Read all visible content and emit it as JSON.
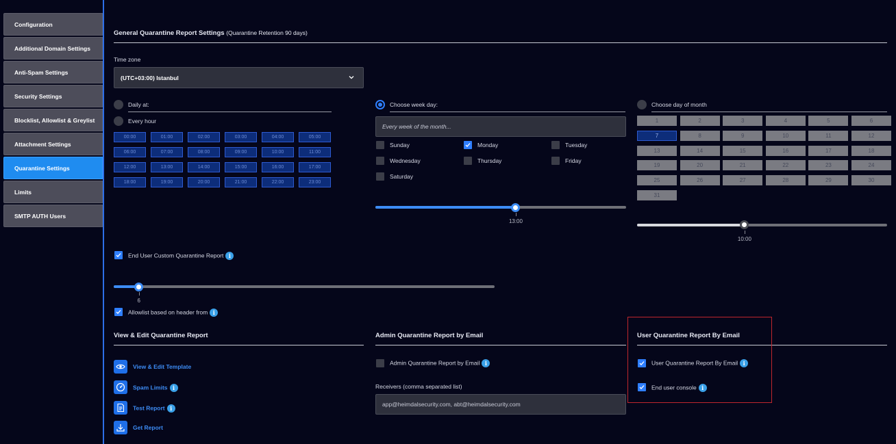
{
  "sidebar": {
    "items": [
      {
        "label": "Configuration",
        "active": false
      },
      {
        "label": "Additional Domain Settings",
        "active": false
      },
      {
        "label": "Anti-Spam Settings",
        "active": false
      },
      {
        "label": "Security Settings",
        "active": false
      },
      {
        "label": "Blocklist, Allowlist & Greylist",
        "active": false
      },
      {
        "label": "Attachment Settings",
        "active": false
      },
      {
        "label": "Quarantine Settings",
        "active": true
      },
      {
        "label": "Limits",
        "active": false
      },
      {
        "label": "SMTP AUTH Users",
        "active": false
      }
    ]
  },
  "general": {
    "title": "General Quarantine Report Settings",
    "subtitle": "(Quarantine Retention 90 days)",
    "timezone_label": "Time zone",
    "timezone_value": "(UTC+03:00) Istanbul"
  },
  "daily": {
    "daily_label": "Daily at:",
    "every_hour_label": "Every hour",
    "hours": [
      "00:00",
      "01:00",
      "02:00",
      "03:00",
      "04:00",
      "05:00",
      "06:00",
      "07:00",
      "08:00",
      "09:00",
      "10:00",
      "11:00",
      "12:00",
      "13:00",
      "14:00",
      "15:00",
      "16:00",
      "17:00",
      "18:00",
      "19:00",
      "20:00",
      "21:00",
      "22:00",
      "23:00"
    ]
  },
  "weekday": {
    "label": "Choose week day:",
    "selected": true,
    "placeholder": "Every week of the month...",
    "days": [
      {
        "label": "Sunday",
        "checked": false
      },
      {
        "label": "Monday",
        "checked": true
      },
      {
        "label": "Tuesday",
        "checked": false
      },
      {
        "label": "Wednesday",
        "checked": false
      },
      {
        "label": "Thursday",
        "checked": false
      },
      {
        "label": "Friday",
        "checked": false
      },
      {
        "label": "Saturday",
        "checked": false
      }
    ],
    "time_value": "13:00",
    "time_fraction": 0.56
  },
  "monthday": {
    "label": "Choose day of month",
    "selected_day": "7",
    "days": [
      "1",
      "2",
      "3",
      "4",
      "5",
      "6",
      "7",
      "8",
      "9",
      "10",
      "11",
      "12",
      "13",
      "14",
      "15",
      "16",
      "17",
      "18",
      "19",
      "20",
      "21",
      "22",
      "23",
      "24",
      "25",
      "26",
      "27",
      "28",
      "29",
      "30",
      "31"
    ],
    "time_value": "10:00",
    "time_fraction": 0.43
  },
  "custom": {
    "end_user_custom_label": "End User Custom Quarantine Report",
    "end_user_custom_checked": true,
    "slider_value": "6",
    "slider_fraction": 0.066,
    "allowlist_label": "Allowlist based on header from",
    "allowlist_checked": true
  },
  "view_edit": {
    "title": "View & Edit Quarantine Report",
    "actions": [
      {
        "label": "View & Edit Template",
        "icon": "eye-icon",
        "info": false
      },
      {
        "label": "Spam Limits",
        "icon": "gauge-icon",
        "info": true
      },
      {
        "label": "Test Report",
        "icon": "document-icon",
        "info": true
      },
      {
        "label": "Get Report",
        "icon": "download-icon",
        "info": false
      }
    ]
  },
  "admin": {
    "title": "Admin Quarantine Report by Email",
    "checkbox_label": "Admin Quarantine Report by Email",
    "checked": false,
    "receivers_label": "Receivers (comma separated list)",
    "receivers_value": "app@heimdalsecurity.com, abt@heimdalsecurity.com"
  },
  "user": {
    "title": "User Quarantine Report By Email",
    "report_label": "User Quarantine Report By Email",
    "report_checked": true,
    "console_label": "End user console",
    "console_checked": true
  },
  "colors": {
    "accent": "#2f7fff",
    "active_nav": "#1f8cf0",
    "highlight_border": "#c0262d"
  }
}
